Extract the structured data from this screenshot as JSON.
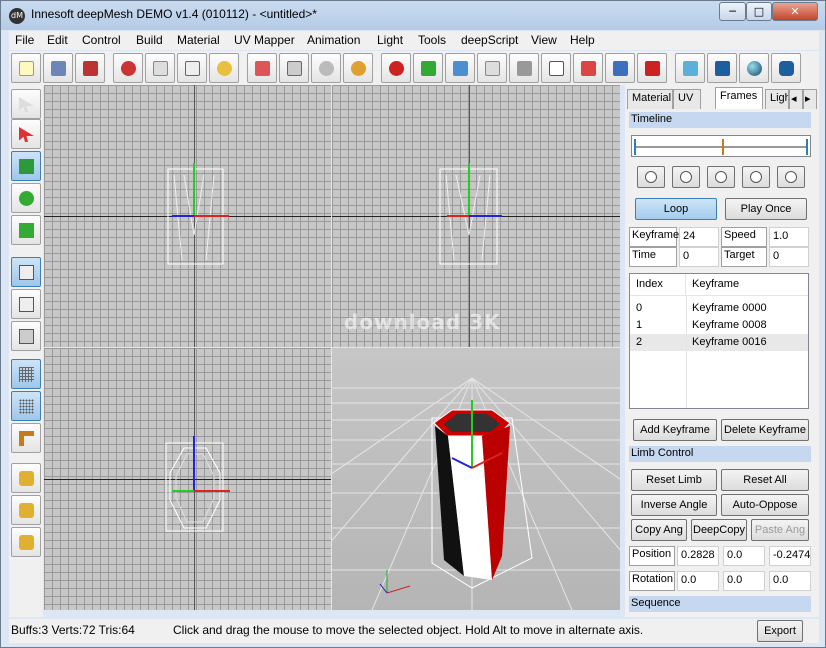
{
  "window": {
    "title": "Innesoft deepMesh DEMO v1.4 (010112) - <untitled>*",
    "app_icon_text": "dM",
    "minimize": "─",
    "maximize": "□",
    "close": "✕"
  },
  "menu": [
    "File",
    "Edit",
    "Control",
    "Build",
    "Material",
    "UV Mapper",
    "Animation",
    "Light",
    "Tools",
    "deepScript",
    "View",
    "Help"
  ],
  "toolbar_icons": [
    "new-file-icon",
    "open-icon",
    "save-icon",
    "cut-icon",
    "copy-icon",
    "paste-icon",
    "undo-icon",
    "delete-icon",
    "align-icon",
    "mesh-icon",
    "group-icon",
    "bind-icon",
    "color-icon",
    "zoom-fit-icon",
    "texture-icon",
    "import-icon",
    "box-icon",
    "cut-mesh-icon",
    "split-icon",
    "merge-icon",
    "plane-icon",
    "cube-icon",
    "sphere-icon",
    "cylinder-icon"
  ],
  "tool_icons": [
    "select-icon",
    "select-red-icon",
    "move-icon",
    "rotate-icon",
    "scale-icon",
    "quad-view-icon",
    "front-view-icon",
    "perspective-view-icon",
    "grid-fine-icon",
    "grid-dots-icon",
    "corner-icon",
    "lock-delete-icon",
    "lock-add-icon",
    "lock-edit-icon"
  ],
  "watermark": "download 3K",
  "panel": {
    "tabs": [
      "Material",
      "UV",
      "Frames",
      "Ligh"
    ],
    "scroll_left": "◂",
    "scroll_right": "▸",
    "timeline_title": "Timeline",
    "loop": "Loop",
    "play_once": "Play Once",
    "keyframe_label": "Keyframe",
    "keyframe_value": "24",
    "speed_label": "Speed",
    "speed_value": "1.0",
    "time_label": "Time",
    "time_value": "0",
    "target_label": "Target",
    "target_value": "0",
    "list_headers": [
      "Index",
      "Keyframe"
    ],
    "rows": [
      [
        "0",
        "Keyframe 0000"
      ],
      [
        "1",
        "Keyframe 0008"
      ],
      [
        "2",
        "Keyframe 0016"
      ]
    ],
    "add_keyframe": "Add Keyframe",
    "delete_keyframe": "Delete Keyframe",
    "limb_title": "Limb Control",
    "reset_limb": "Reset Limb",
    "reset_all": "Reset All",
    "inverse_angle": "Inverse Angle",
    "auto_oppose": "Auto-Oppose",
    "copy_ang": "Copy Ang",
    "deep_copy": "DeepCopy",
    "paste_ang": "Paste Ang",
    "position_label": "Position",
    "position": [
      "0.2828",
      "0.0",
      "-0.2474"
    ],
    "rotation_label": "Rotation",
    "rotation": [
      "0.0",
      "0.0",
      "0.0"
    ],
    "sequence_title": "Sequence"
  },
  "status": {
    "stats": "Buffs:3 Verts:72 Tris:64",
    "message": "Click and drag the mouse to move the selected object. Hold Alt to move in alternate axis.",
    "export": "Export"
  }
}
